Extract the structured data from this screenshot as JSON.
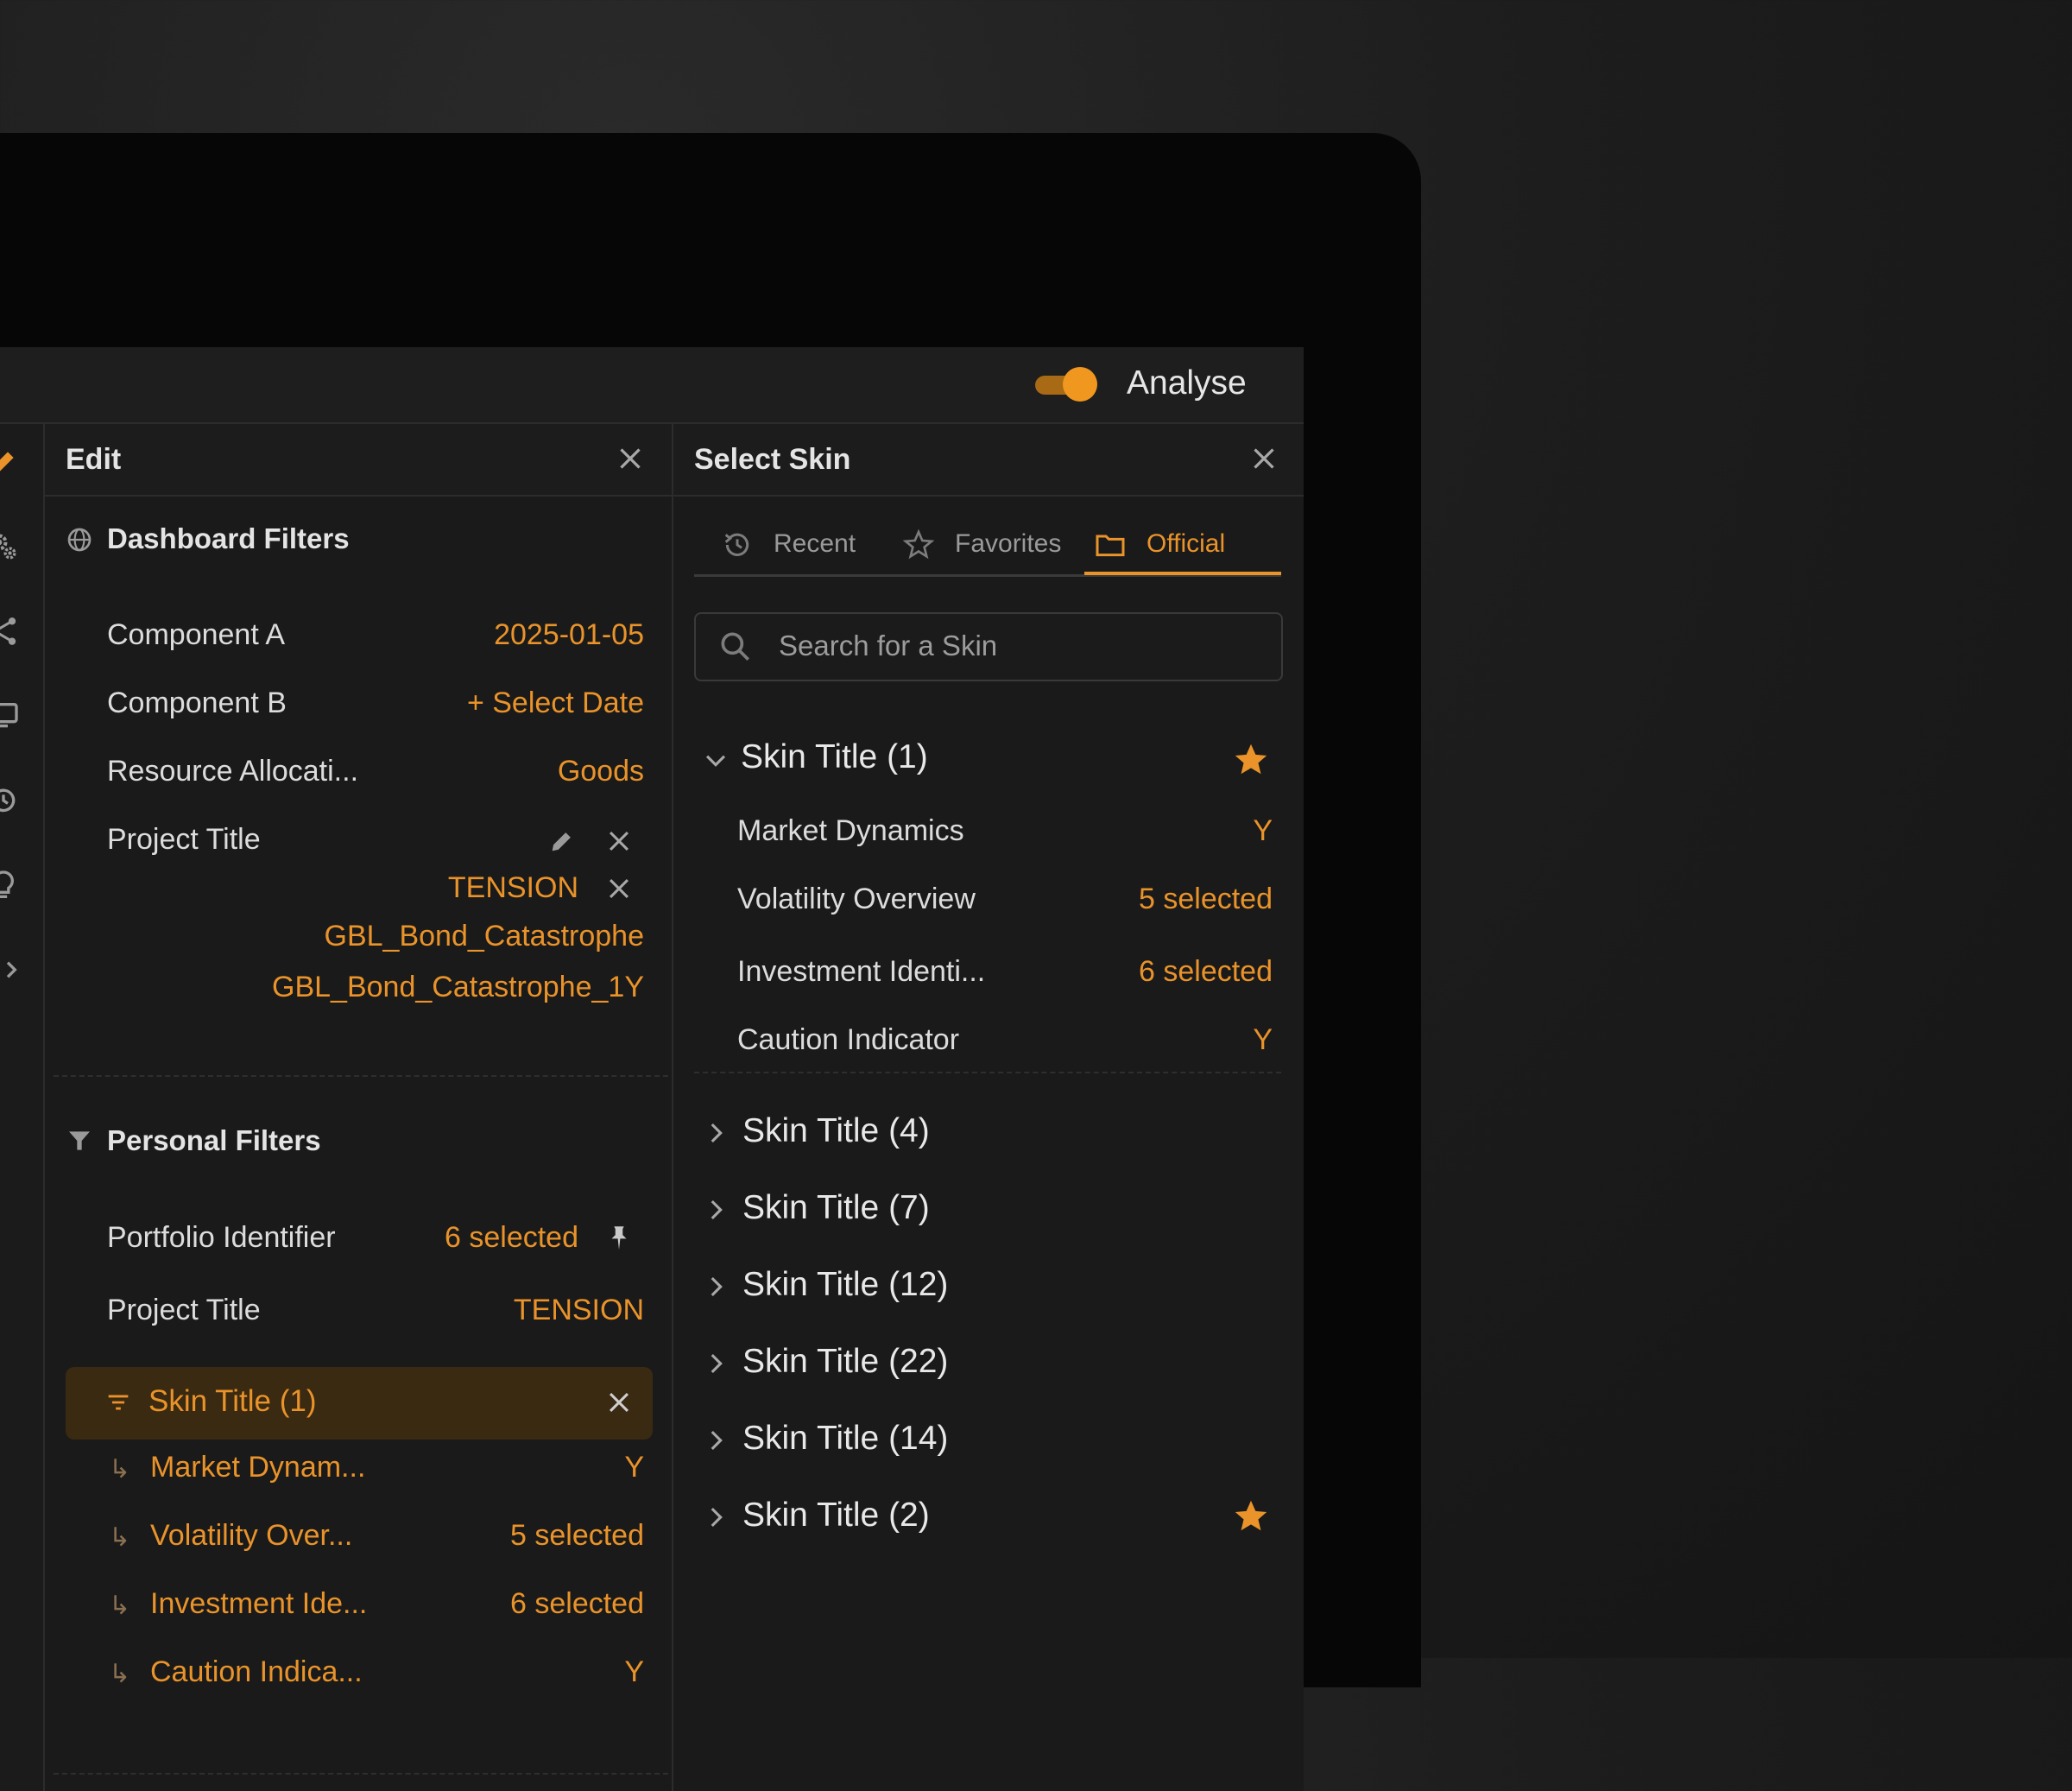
{
  "topbar": {
    "toggle_label": "Analyse",
    "toggle_on": true
  },
  "colors": {
    "accent": "#e9932a",
    "background": "#1a1a1a",
    "chip": "#3b2a12"
  },
  "rail": {
    "items": [
      {
        "name": "pencil-icon",
        "active": true
      },
      {
        "name": "gears-icon"
      },
      {
        "name": "share-icon"
      },
      {
        "name": "monitor-icon"
      },
      {
        "name": "history-icon"
      },
      {
        "name": "lightbulb-icon"
      },
      {
        "name": "code-icon"
      }
    ]
  },
  "edit_panel": {
    "title": "Edit",
    "dashboard_filters": {
      "title": "Dashboard Filters",
      "rows": [
        {
          "label": "Component A",
          "value": "2025-01-05"
        },
        {
          "label": "Component B",
          "value": "+ Select Date"
        },
        {
          "label": "Resource Allocati...",
          "value": "Goods"
        },
        {
          "label": "Project Title"
        }
      ],
      "project_values": [
        "TENSION",
        "GBL_Bond_Catastrophe",
        "GBL_Bond_Catastrophe_1Y"
      ]
    },
    "personal_filters": {
      "title": "Personal Filters",
      "rows": [
        {
          "label": "Portfolio Identifier",
          "value": "6 selected"
        },
        {
          "label": "Project Title",
          "value": "TENSION"
        }
      ],
      "active_skin": "Skin Title (1)",
      "sub_rows": [
        {
          "label": "Market Dynam...",
          "value": "Y"
        },
        {
          "label": "Volatility Over...",
          "value": "5 selected"
        },
        {
          "label": "Investment Ide...",
          "value": "6 selected"
        },
        {
          "label": "Caution Indica...",
          "value": "Y"
        }
      ],
      "sub_arrow": "↳"
    }
  },
  "skin_panel": {
    "title": "Select Skin",
    "tabs": [
      {
        "label": "Recent",
        "icon": "history-icon"
      },
      {
        "label": "Favorites",
        "icon": "star-outline-icon"
      },
      {
        "label": "Official",
        "icon": "folder-icon",
        "active": true
      }
    ],
    "search_placeholder": "Search for a Skin",
    "expanded_group": {
      "title": "Skin Title (1)",
      "favorite": true,
      "items": [
        {
          "label": "Market Dynamics",
          "value": "Y"
        },
        {
          "label": "Volatility Overview",
          "value": "5 selected"
        },
        {
          "label": "Investment Identi...",
          "value": "6 selected"
        },
        {
          "label": "Caution Indicator",
          "value": "Y"
        }
      ]
    },
    "groups": [
      {
        "title": "Skin Title (4)",
        "favorite": false
      },
      {
        "title": "Skin Title (7)",
        "favorite": false
      },
      {
        "title": "Skin Title (12)",
        "favorite": false
      },
      {
        "title": "Skin Title (22)",
        "favorite": false
      },
      {
        "title": "Skin Title (14)",
        "favorite": false
      },
      {
        "title": "Skin Title (2)",
        "favorite": true
      }
    ]
  }
}
